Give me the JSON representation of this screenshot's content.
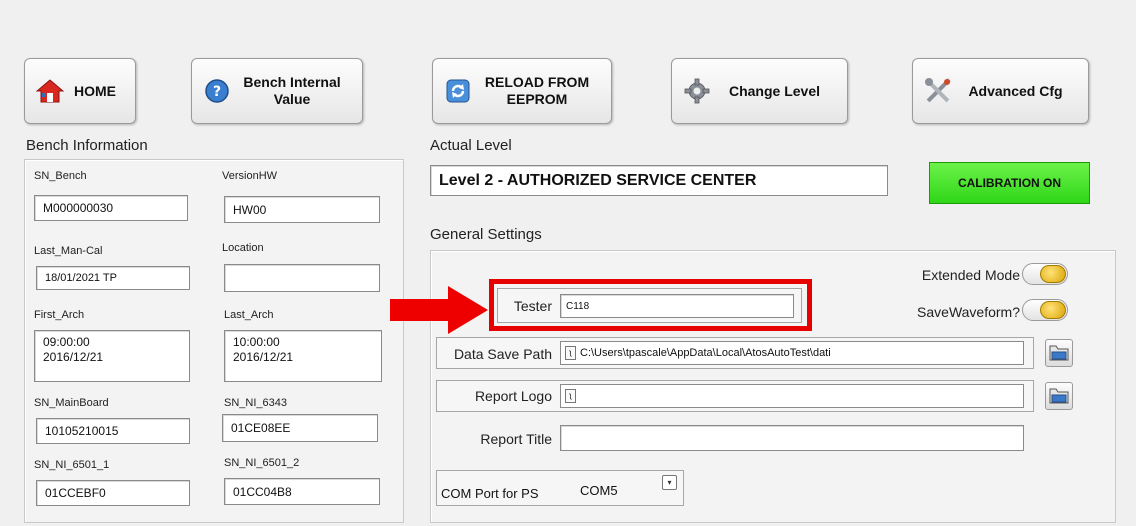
{
  "toolbar": {
    "home": "HOME",
    "bench_internal": "Bench Internal\nValue",
    "reload": "RELOAD FROM\nEEPROM",
    "change_level": "Change Level",
    "advanced": "Advanced Cfg"
  },
  "bench": {
    "title": "Bench Information",
    "sn_bench_label": "SN_Bench",
    "sn_bench": "M000000030",
    "version_hw_label": "VersionHW",
    "version_hw": "HW00",
    "last_man_cal_label": "Last_Man-Cal",
    "last_man_cal": "18/01/2021 TP",
    "location_label": "Location",
    "location": "",
    "first_arch_label": "First_Arch",
    "first_arch_time": "09:00:00",
    "first_arch_date": "2016/12/21",
    "last_arch_label": "Last_Arch",
    "last_arch_time": "10:00:00",
    "last_arch_date": "2016/12/21",
    "sn_mainboard_label": "SN_MainBoard",
    "sn_mainboard": "10105210015",
    "sn_ni_6343_label": "SN_NI_6343",
    "sn_ni_6343": "01CE08EE",
    "sn_ni_6501_1_label": "SN_NI_6501_1",
    "sn_ni_6501_1": "01CCEBF0",
    "sn_ni_6501_2_label": "SN_NI_6501_2",
    "sn_ni_6501_2": "01CC04B8"
  },
  "level": {
    "title": "Actual Level",
    "value": "Level 2 - AUTHORIZED SERVICE CENTER",
    "calibration": "CALIBRATION ON"
  },
  "settings": {
    "title": "General Settings",
    "extended_mode": "Extended Mode",
    "save_waveform": "SaveWaveform?",
    "tester_label": "Tester",
    "tester": "C118",
    "data_save_path_label": "Data Save Path",
    "data_save_path": "C:\\Users\\tpascale\\AppData\\Local\\AtosAutoTest\\dati",
    "report_logo_label": "Report Logo",
    "report_logo": "",
    "report_title_label": "Report Title",
    "report_title": "",
    "com_port_label": "COM Port for PS",
    "com_port": "COM5"
  },
  "colors": {
    "highlight": "#e60000",
    "calibration": "#3ee21f"
  },
  "icons": [
    "home-icon",
    "help-icon",
    "reload-icon",
    "gear-icon",
    "tools-icon",
    "folder-icon",
    "arrow-icon"
  ]
}
